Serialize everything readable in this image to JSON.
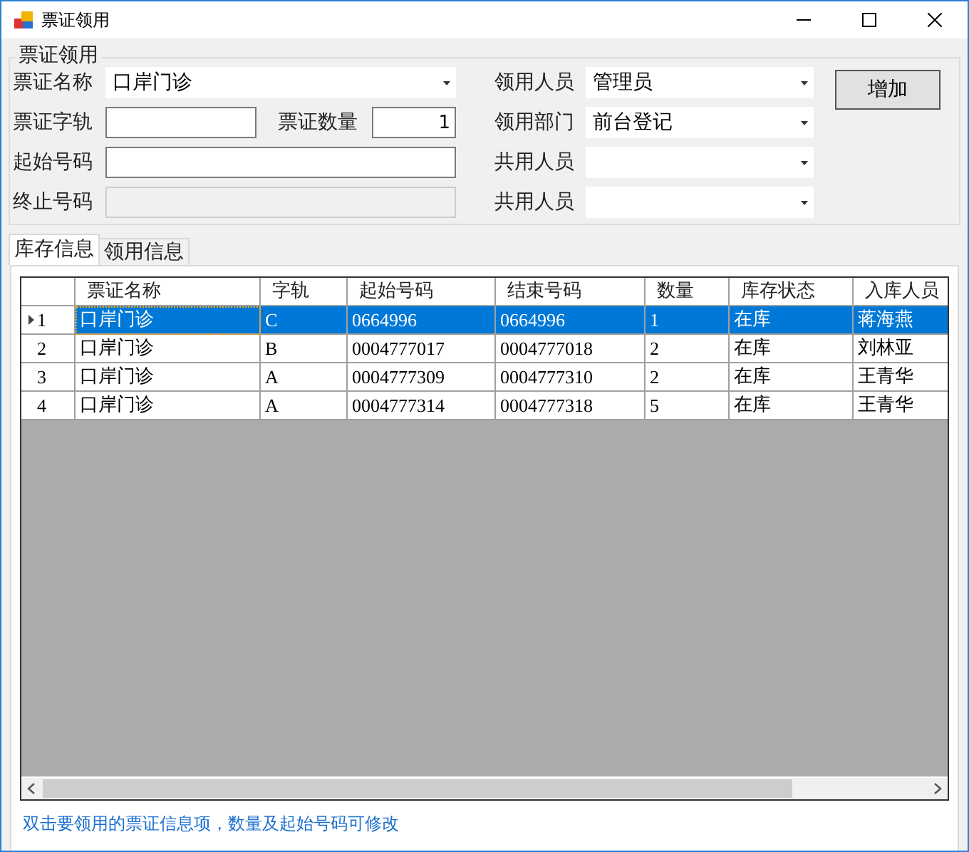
{
  "window": {
    "title": "票证领用"
  },
  "form": {
    "group_title": "票证领用",
    "left_rows": [
      {
        "fields": [
          {
            "label": "票证名称",
            "kind": "combo",
            "value": "口岸门诊"
          }
        ]
      },
      {
        "fields": [
          {
            "label": "票证字轨",
            "kind": "text",
            "disabled": false
          },
          {
            "label": "票证数量",
            "kind": "number",
            "value": "1",
            "disabled": false
          }
        ]
      },
      {
        "fields": [
          {
            "label": "起始号码",
            "kind": "text",
            "disabled": false
          }
        ]
      },
      {
        "fields": [
          {
            "label": "终止号码",
            "kind": "text",
            "disabled": true
          }
        ]
      }
    ],
    "right_rows": [
      {
        "label": "领用人员",
        "kind": "combo",
        "value": "管理员"
      },
      {
        "label": "领用部门",
        "kind": "combo",
        "value": "前台登记"
      },
      {
        "label": "共用人员",
        "kind": "combo"
      },
      {
        "label": "共用人员",
        "kind": "combo"
      }
    ],
    "button": "增加"
  },
  "tabs": [
    {
      "label": "库存信息",
      "selected": true
    },
    {
      "label": "领用信息",
      "selected": false
    }
  ],
  "table": {
    "columns": [
      "票证名称",
      "字轨",
      "起始号码",
      "结束号码",
      "数量",
      "库存状态",
      "入库人员"
    ],
    "rows": [
      {
        "number": "1",
        "selected": true,
        "cells": [
          "口岸门诊",
          "C",
          "0664996",
          "0664996",
          "1",
          "在库",
          "蒋海燕"
        ]
      },
      {
        "number": "2",
        "selected": false,
        "cells": [
          "口岸门诊",
          "B",
          "0004777017",
          "0004777018",
          "2",
          "在库",
          "刘林亚"
        ]
      },
      {
        "number": "3",
        "selected": false,
        "cells": [
          "口岸门诊",
          "A",
          "0004777309",
          "0004777310",
          "2",
          "在库",
          "王青华"
        ]
      },
      {
        "number": "4",
        "selected": false,
        "cells": [
          "口岸门诊",
          "A",
          "0004777314",
          "0004777318",
          "5",
          "在库",
          "王青华"
        ]
      }
    ]
  },
  "status_hint": "双击要领用的票证信息项，数量及起始号码可修改"
}
